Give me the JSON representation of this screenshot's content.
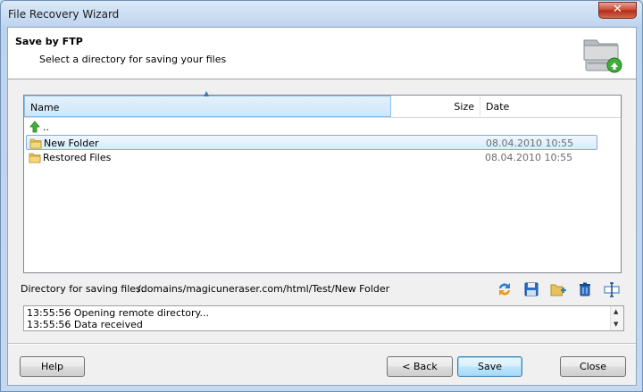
{
  "window": {
    "title": "File Recovery Wizard",
    "close_glyph": "✕"
  },
  "header": {
    "title": "Save by FTP",
    "subtitle": "Select a directory for saving your files",
    "icon": "ftp-server-folder-icon"
  },
  "file_list": {
    "columns": {
      "name": "Name",
      "size": "Size",
      "date": "Date"
    },
    "sort_indicator": "▲",
    "rows": [
      {
        "name": "..",
        "size": "",
        "date": "",
        "icon": "up-arrow-icon",
        "selected": false
      },
      {
        "name": "New Folder",
        "size": "",
        "date": "08.04.2010 10:55",
        "icon": "folder-icon",
        "selected": true
      },
      {
        "name": "Restored Files",
        "size": "",
        "date": "08.04.2010 10:55",
        "icon": "folder-icon",
        "selected": false
      }
    ]
  },
  "directory": {
    "label": "Directory for saving files:",
    "value": "/domains/magicuneraser.com/html/Test/New Folder"
  },
  "toolbar": [
    "refresh-icon",
    "save-disk-icon",
    "new-folder-icon",
    "delete-icon",
    "rename-icon"
  ],
  "log": {
    "lines": [
      "13:55:56 Opening remote directory...",
      "13:55:56 Data received"
    ],
    "scroll_up": "▲",
    "scroll_down": "▼"
  },
  "buttons": {
    "help": "Help",
    "back": "< Back",
    "save": "Save",
    "close": "Close"
  }
}
